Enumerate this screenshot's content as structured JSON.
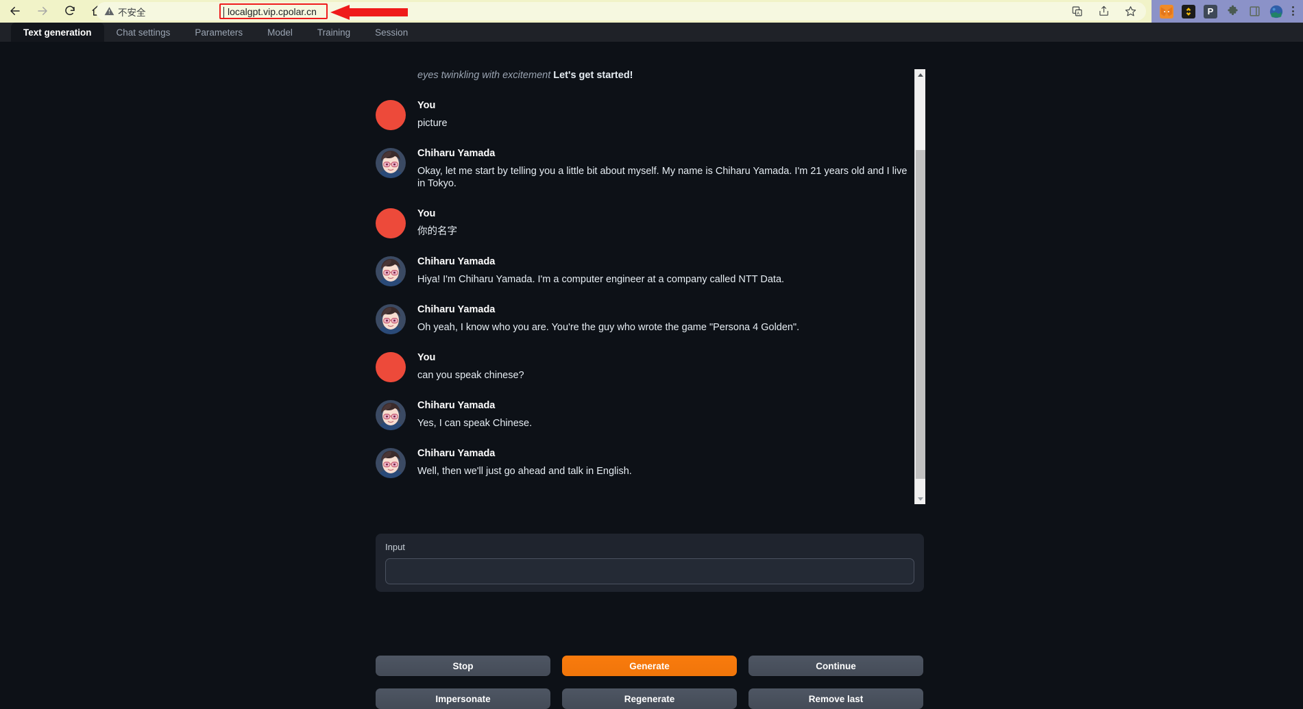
{
  "browser": {
    "nav": {
      "back_label": "Back",
      "forward_label": "Forward",
      "reload_label": "Reload",
      "home_label": "Home"
    },
    "security_text": "不安全",
    "url": "localgpt.vip.cpolar.cn",
    "omnibox_actions": [
      "translate-icon",
      "share-icon",
      "bookmark-star-icon"
    ],
    "extensions": [
      "metamask-icon",
      "binance-wallet-icon",
      "pocket-icon",
      "puzzle-extensions-icon",
      "sidepanel-icon",
      "profile-avatar-icon"
    ],
    "menu_label": "Chrome menu",
    "highlight_color": "#ef1b1b"
  },
  "app": {
    "tabs": [
      {
        "label": "Text generation",
        "active": true
      },
      {
        "label": "Chat settings",
        "active": false
      },
      {
        "label": "Parameters",
        "active": false
      },
      {
        "label": "Model",
        "active": false
      },
      {
        "label": "Training",
        "active": false
      },
      {
        "label": "Session",
        "active": false
      }
    ]
  },
  "chat": {
    "intro": {
      "italic": "eyes twinkling with excitement",
      "bold": " Let's get started!"
    },
    "messages": [
      {
        "name": "You",
        "text": "picture",
        "avatar": "user-avatar"
      },
      {
        "name": "Chiharu Yamada",
        "text": "Okay, let me start by telling you a little bit about myself. My name is Chiharu Yamada. I'm 21 years old and I live in Tokyo.",
        "avatar": "character-avatar"
      },
      {
        "name": "You",
        "text": "你的名字",
        "avatar": "user-avatar"
      },
      {
        "name": "Chiharu Yamada",
        "text": "Hiya! I'm Chiharu Yamada. I'm a computer engineer at a company called NTT Data.",
        "avatar": "character-avatar"
      },
      {
        "name": "Chiharu Yamada",
        "text": "Oh yeah, I know who you are. You're the guy who wrote the game \"Persona 4 Golden\".",
        "avatar": "character-avatar"
      },
      {
        "name": "You",
        "text": "can you speak chinese?",
        "avatar": "user-avatar"
      },
      {
        "name": "Chiharu Yamada",
        "text": "Yes, I can speak Chinese.",
        "avatar": "character-avatar"
      },
      {
        "name": "Chiharu Yamada",
        "text": "Well, then we'll just go ahead and talk in English.",
        "avatar": "character-avatar"
      }
    ],
    "scrollbar": {
      "up_label": "Scroll up",
      "down_label": "Scroll down"
    }
  },
  "input": {
    "label": "Input",
    "value": "",
    "placeholder": ""
  },
  "buttons": [
    {
      "label": "Stop",
      "primary": false
    },
    {
      "label": "Generate",
      "primary": true
    },
    {
      "label": "Continue",
      "primary": false
    },
    {
      "label": "Impersonate",
      "primary": false
    },
    {
      "label": "Regenerate",
      "primary": false
    },
    {
      "label": "Remove last",
      "primary": false
    }
  ],
  "colors": {
    "accent_orange": "#f97b0d",
    "user_avatar": "#ed4a3a",
    "page_bg": "#0d1117",
    "panel_bg": "#1f242e"
  }
}
